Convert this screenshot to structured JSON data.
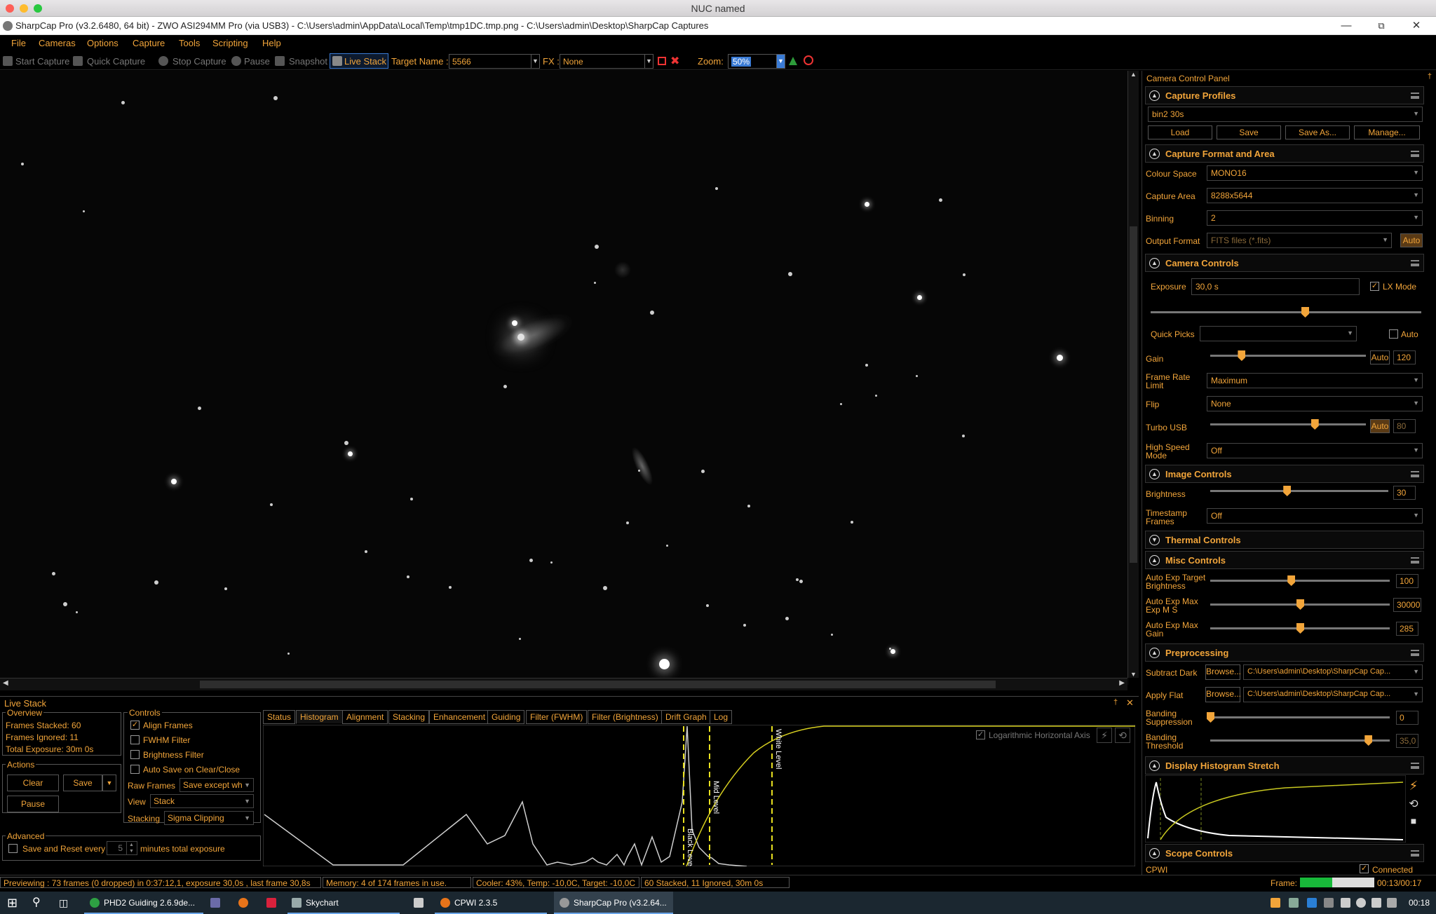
{
  "mac_title": "NUC named",
  "window_title": "SharpCap Pro (v3.2.6480, 64 bit) - ZWO ASI294MM Pro (via USB3) - C:\\Users\\admin\\AppData\\Local\\Temp\\tmp1DC.tmp.png - C:\\Users\\admin\\Desktop\\SharpCap Captures",
  "menu": [
    "File",
    "Cameras",
    "Options",
    "Capture",
    "Tools",
    "Scripting",
    "Help"
  ],
  "toolbar": {
    "start_capture": "Start Capture",
    "quick_capture": "Quick Capture",
    "stop_capture": "Stop Capture",
    "pause": "Pause",
    "snapshot": "Snapshot",
    "live_stack": "Live Stack",
    "target_name_label": "Target Name :",
    "target_name_value": "5566",
    "fx_label": "FX :",
    "fx_value": "None",
    "zoom_label": "Zoom:",
    "zoom_value": "50%"
  },
  "camera_panel": {
    "title": "Camera Control Panel",
    "capture_profiles": {
      "header": "Capture Profiles",
      "selected": "bin2 30s",
      "buttons": [
        "Load",
        "Save",
        "Save As...",
        "Manage..."
      ]
    },
    "capture_format": {
      "header": "Capture Format and Area",
      "colour_space_label": "Colour Space",
      "colour_space": "MONO16",
      "capture_area_label": "Capture Area",
      "capture_area": "8288x5644",
      "binning_label": "Binning",
      "binning": "2",
      "output_format_label": "Output Format",
      "output_format": "FITS files (*.fits)",
      "auto": "Auto"
    },
    "camera_controls": {
      "header": "Camera Controls",
      "exposure_label": "Exposure",
      "exposure": "30,0 s",
      "lx_mode": "LX Mode",
      "exposure_level": 0.57,
      "quick_picks_label": "Quick Picks",
      "quick_picks_auto": "Auto",
      "gain_label": "Gain",
      "gain_auto": "Auto",
      "gain": "120",
      "gain_level": 0.2,
      "frame_rate_label": "Frame Rate Limit",
      "frame_rate": "Maximum",
      "flip_label": "Flip",
      "flip": "None",
      "turbo_usb_label": "Turbo USB",
      "turbo_auto": "Auto",
      "turbo_usb": "80",
      "turbo_level": 0.67,
      "high_speed_label": "High Speed Mode",
      "high_speed": "Off"
    },
    "image_controls": {
      "header": "Image Controls",
      "brightness_label": "Brightness",
      "brightness": "30",
      "brightness_level": 0.43,
      "timestamp_label": "Timestamp Frames",
      "timestamp": "Off"
    },
    "thermal_controls": {
      "header": "Thermal Controls"
    },
    "misc_controls": {
      "header": "Misc Controls",
      "auto_exp_target_label": "Auto Exp Target Brightness",
      "auto_exp_target": "100",
      "auto_exp_target_level": 0.45,
      "auto_exp_max_ms_label": "Auto Exp Max Exp M S",
      "auto_exp_max_ms": "30000",
      "auto_exp_max_ms_level": 0.5,
      "auto_exp_max_gain_label": "Auto Exp Max Gain",
      "auto_exp_max_gain": "285",
      "auto_exp_max_gain_level": 0.5
    },
    "preprocessing": {
      "header": "Preprocessing",
      "subtract_dark_label": "Subtract Dark",
      "browse": "Browse...",
      "subtract_dark": "C:\\Users\\admin\\Desktop\\SharpCap Cap...",
      "apply_flat_label": "Apply Flat",
      "apply_flat": "C:\\Users\\admin\\Desktop\\SharpCap Cap...",
      "banding_suppression_label": "Banding Suppression",
      "banding_suppression": "0",
      "banding_suppression_level": 0.0,
      "banding_threshold_label": "Banding Threshold",
      "banding_threshold": "35,0",
      "banding_threshold_level": 0.88
    },
    "histogram_stretch": {
      "header": "Display Histogram Stretch"
    },
    "scope_controls": {
      "header": "Scope Controls",
      "scope": "CPWI",
      "connected": "Connected"
    }
  },
  "live_stack": {
    "title": "Live Stack",
    "overview_label": "Overview",
    "frames_stacked": "Frames Stacked:  60",
    "frames_ignored": "Frames Ignored:  11",
    "total_exposure": "Total Exposure:  30m 0s",
    "actions_label": "Actions",
    "clear": "Clear",
    "save": "Save",
    "pause": "Pause",
    "advanced_label": "Advanced",
    "save_reset_every": "Save and Reset every",
    "save_reset_value": "5",
    "minutes_total": "minutes total exposure",
    "controls_label": "Controls",
    "align_frames": "Align Frames",
    "fwhm_filter": "FWHM Filter",
    "brightness_filter": "Brightness Filter",
    "auto_save": "Auto Save on Clear/Close",
    "raw_frames_label": "Raw Frames",
    "raw_frames": "Save except wh",
    "view_label": "View",
    "view": "Stack",
    "stacking_label": "Stacking",
    "stacking": "Sigma Clipping",
    "tabs": [
      "Status",
      "Histogram",
      "Alignment",
      "Stacking",
      "Enhancement",
      "Guiding",
      "Filter (FWHM)",
      "Filter (Brightness)",
      "Drift Graph",
      "Log"
    ],
    "log_axis": "Logarithmic Horizontal Axis",
    "black_level": "Black Level",
    "mid_level": "Mid Level",
    "white_level": "White Level"
  },
  "status_bar": {
    "preview": "Previewing : 73 frames (0 dropped) in 0:37:12,1, exposure 30,0s , last frame 30,8s",
    "memory": "Memory: 4 of 174 frames in use.",
    "cooler": "Cooler: 43%, Temp: -10,0C, Target: -10,0C",
    "stacked": "60 Stacked, 11 Ignored, 30m 0s",
    "frame_label": "Frame:",
    "frame_time": "00:13/00:17",
    "frame_progress": 0.43
  },
  "taskbar": {
    "apps": [
      "PHD2 Guiding 2.6.9de...",
      "Skychart",
      "CPWI 2.3.5",
      "SharpCap Pro (v3.2.64..."
    ],
    "clock": "00:18"
  },
  "colors": {
    "accent": "#f2a53a",
    "background": "#000000",
    "highlight": "#3a7bd5"
  }
}
